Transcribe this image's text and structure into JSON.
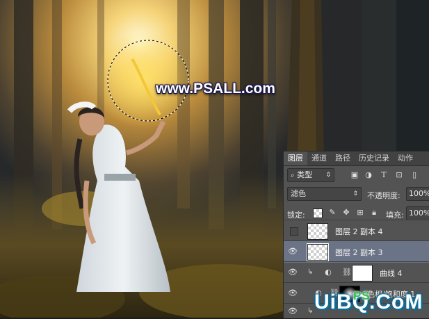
{
  "watermark": "www.PSALL.com",
  "corner_watermark": {
    "text": "UiBQ.CoM",
    "sub": "PS"
  },
  "panel": {
    "tabs": [
      {
        "label": "图层",
        "active": true
      },
      {
        "label": "通道",
        "active": false
      },
      {
        "label": "路径",
        "active": false
      },
      {
        "label": "历史记录",
        "active": false
      },
      {
        "label": "动作",
        "active": false
      }
    ],
    "filter_label": "类型",
    "blend_mode": "滤色",
    "opacity_label": "不透明度:",
    "opacity_value": "100%",
    "lock_label": "锁定:",
    "fill_label": "填充:",
    "fill_value": "100%",
    "layers": [
      {
        "name": "图层 2 副本 4",
        "visible": false,
        "selected": false
      },
      {
        "name": "图层 2 副本 3",
        "visible": true,
        "selected": true
      },
      {
        "name": "曲线 4",
        "visible": true,
        "selected": false
      },
      {
        "name": "色相/饱和度 1",
        "visible": true,
        "selected": false
      }
    ]
  }
}
